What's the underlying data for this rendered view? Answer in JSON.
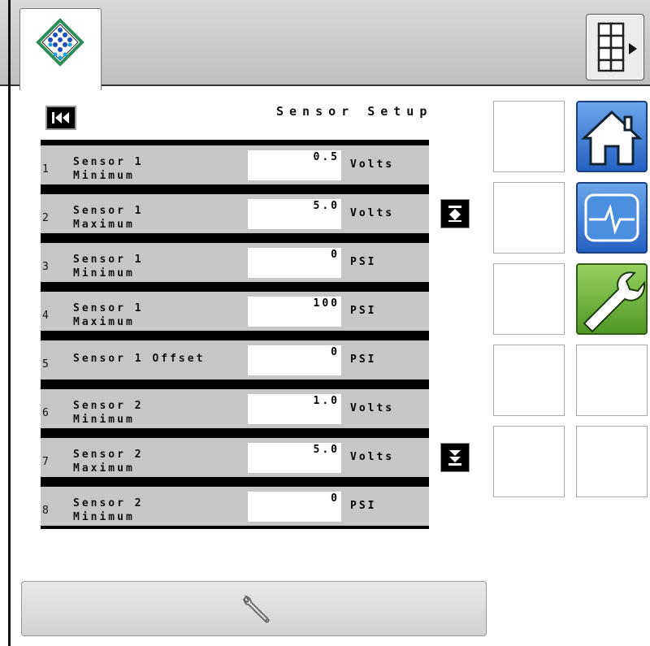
{
  "header": {
    "title": "Sensor Setup"
  },
  "rows": [
    {
      "number": "1",
      "label": "Sensor 1\nMinimum",
      "value": "0.5",
      "unit": "Volts"
    },
    {
      "number": "2",
      "label": "Sensor 1\nMaximum",
      "value": "5.0",
      "unit": "Volts"
    },
    {
      "number": "3",
      "label": "Sensor 1\nMinimum",
      "value": "0",
      "unit": "PSI"
    },
    {
      "number": "4",
      "label": "Sensor 1\nMaximum",
      "value": "100",
      "unit": "PSI"
    },
    {
      "number": "5",
      "label": "Sensor 1 Offset",
      "value": "0",
      "unit": "PSI"
    },
    {
      "number": "6",
      "label": "Sensor 2\nMinimum",
      "value": "1.0",
      "unit": "Volts"
    },
    {
      "number": "7",
      "label": "Sensor 2\nMaximum",
      "value": "5.0",
      "unit": "Volts"
    },
    {
      "number": "8",
      "label": "Sensor 2\nMinimum",
      "value": "0",
      "unit": "PSI"
    }
  ],
  "icons": {
    "logo": "diamond-dots-logo-icon",
    "menu": "grid-menu-icon",
    "rewind": "skip-to-start-icon",
    "scroll_up": "scroll-to-top-icon",
    "scroll_down": "scroll-to-bottom-icon",
    "home": "home-icon",
    "diagnostics": "pulse-monitor-icon",
    "tools": "wrench-icon"
  },
  "colors": {
    "row_bg": "#c6c6c6",
    "home_tile": "#3f7fd6",
    "diag_tile": "#3f7fd6",
    "tool_tile": "#6fb33a"
  }
}
